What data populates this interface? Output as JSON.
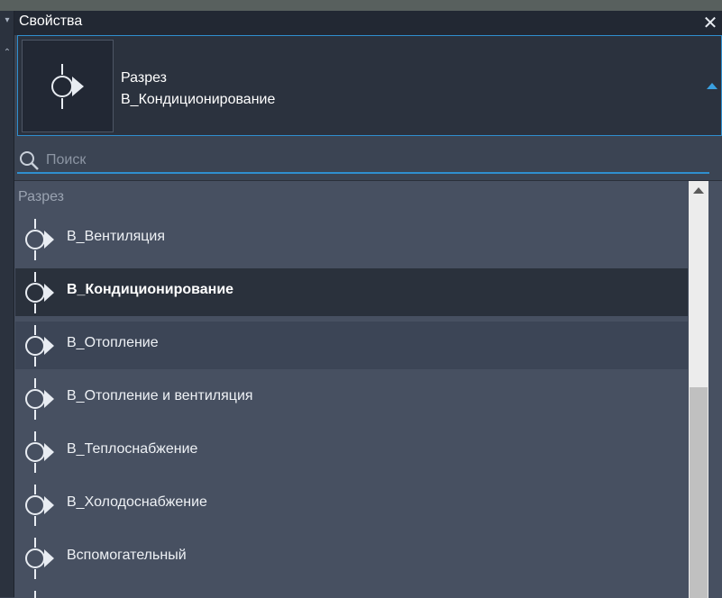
{
  "panel": {
    "title": "Свойства",
    "close_glyph": "✕"
  },
  "type_selector": {
    "category": "Разрез",
    "type_name": "В_Кондиционирование",
    "preview_icon": "section-marker-icon",
    "expand_icon": "triangle-up-icon"
  },
  "search": {
    "placeholder": "Поиск",
    "value": ""
  },
  "list": {
    "group_header": "Разрез",
    "items": [
      {
        "label": "В_Вентиляция",
        "state": "normal"
      },
      {
        "label": "В_Кондиционирование",
        "state": "selected"
      },
      {
        "label": "В_Отопление",
        "state": "hover"
      },
      {
        "label": "В_Отопление и вентиляция",
        "state": "normal"
      },
      {
        "label": "В_Теплоснабжение",
        "state": "normal"
      },
      {
        "label": "В_Холодоснабжение",
        "state": "normal"
      },
      {
        "label": "Вспомогательный",
        "state": "normal"
      }
    ]
  },
  "colors": {
    "accent": "#2f8fcf",
    "panel_bg": "#2b323e",
    "list_bg": "#475061",
    "selected_bg": "#2a313c"
  }
}
